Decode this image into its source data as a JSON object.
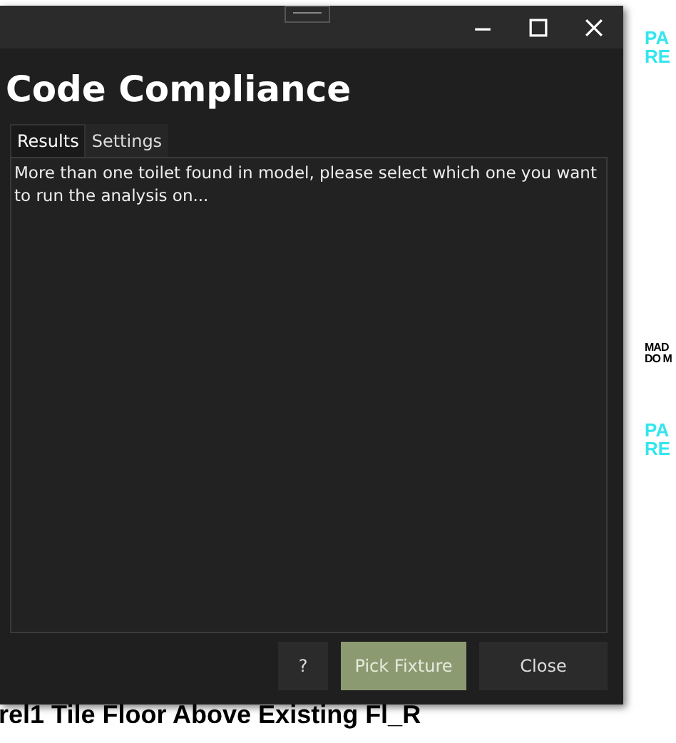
{
  "background_drawing": {
    "tags": [
      {
        "kind": "cyan",
        "lines": [
          "PA",
          "RE"
        ]
      },
      {
        "kind": "black",
        "lines": [
          "MAD",
          "DO M"
        ]
      },
      {
        "kind": "cyan",
        "lines": [
          "PA",
          "RE"
        ]
      }
    ],
    "bottom_label": "rel1 Tile Floor Above Existing Fl_R"
  },
  "window": {
    "title": "Code Compliance",
    "tabs": [
      {
        "label": "Results",
        "selected": true
      },
      {
        "label": "Settings",
        "selected": false
      }
    ],
    "message": "More than one toilet found in model, please select which one you want to run the analysis on...",
    "buttons": [
      {
        "label": "?",
        "kind": "plain"
      },
      {
        "label": "Pick Fixture",
        "kind": "primary"
      },
      {
        "label": "Close",
        "kind": "plain"
      }
    ]
  }
}
